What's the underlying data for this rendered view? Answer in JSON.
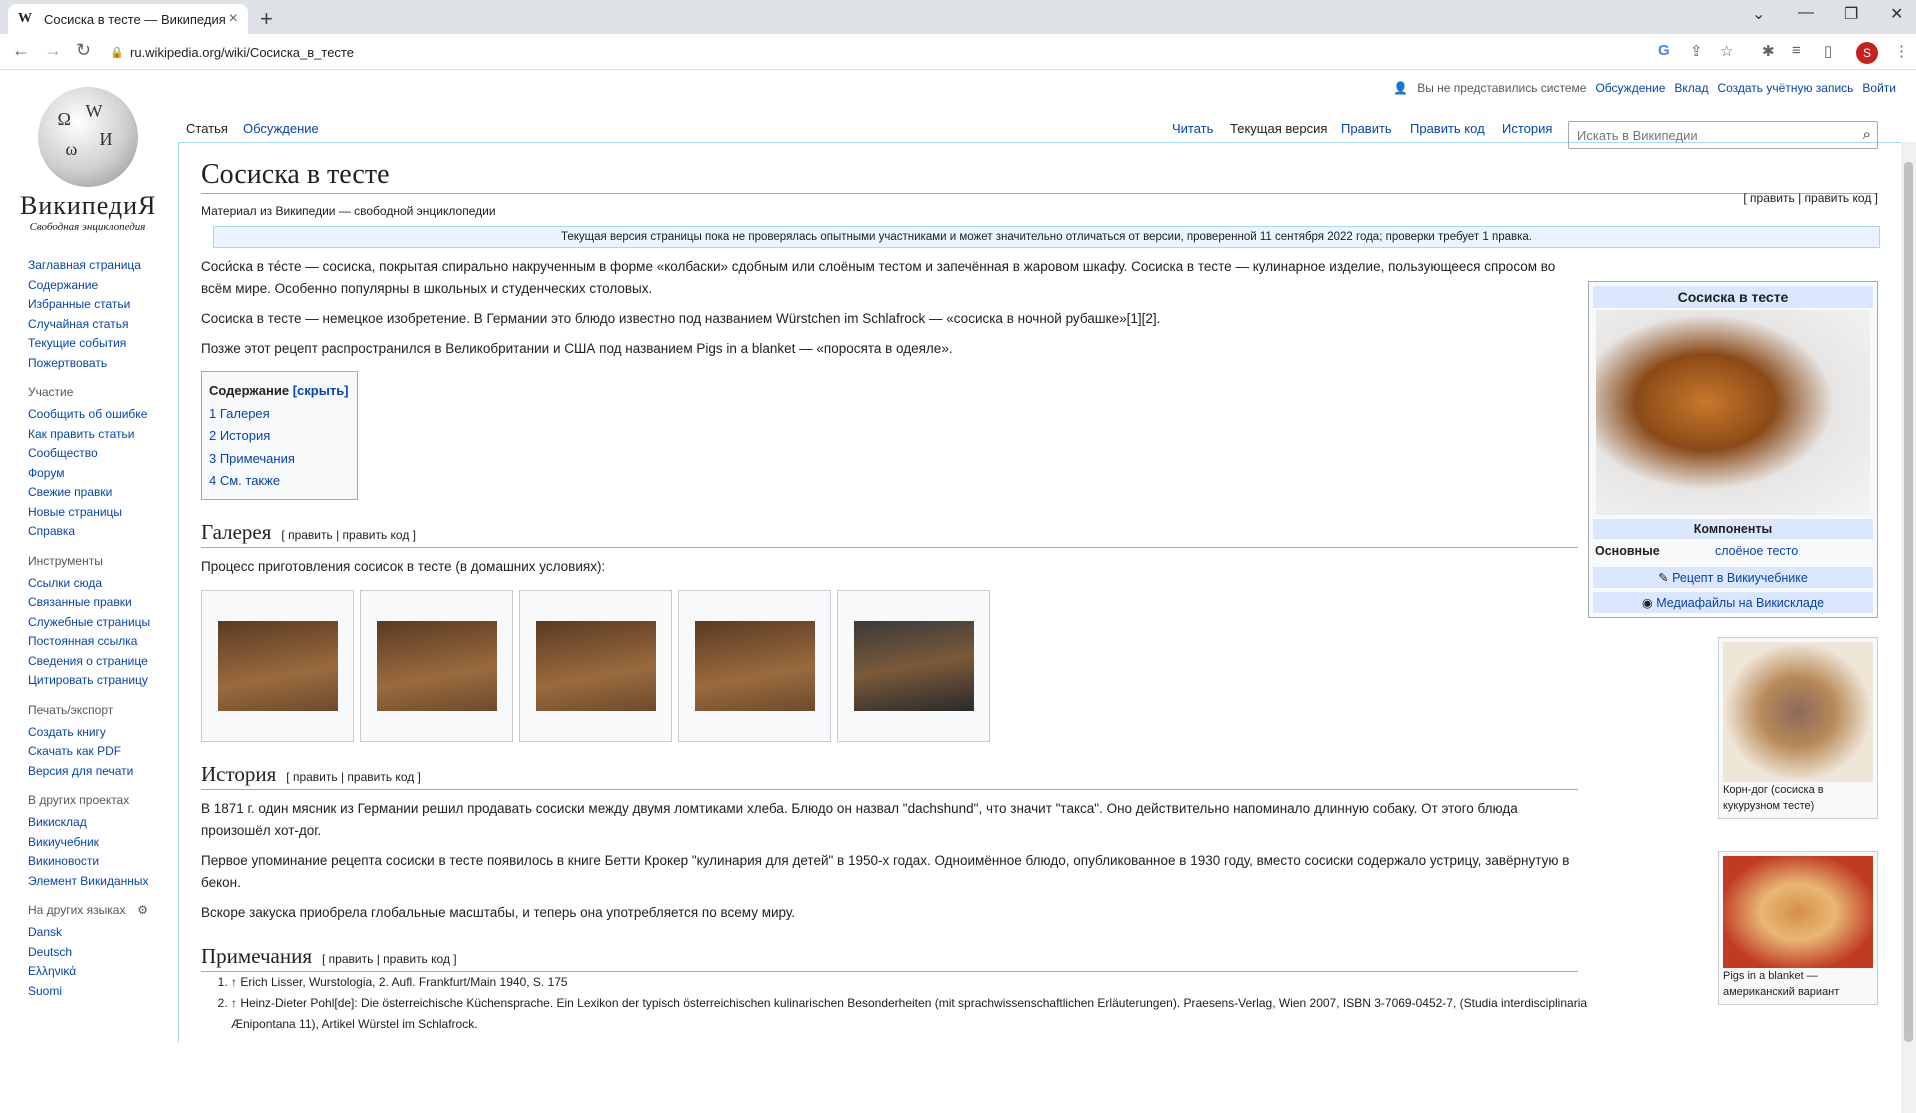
{
  "browser": {
    "tab_title": "Сосиска в тесте — Википедия",
    "url": "ru.wikipedia.org/wiki/Сосиска_в_тесте",
    "profile_letter": "S"
  },
  "logo": {
    "wordmark": "ВикипедиЯ",
    "tagline": "Свободная энциклопедия"
  },
  "personal": {
    "not_logged": "Вы не представились системе",
    "talk": "Обсуждение",
    "contrib": "Вклад",
    "create": "Создать учётную запись",
    "login": "Войти"
  },
  "tabs": {
    "article": "Статья",
    "talk": "Обсуждение",
    "read": "Читать",
    "current": "Текущая версия",
    "edit": "Править",
    "editcode": "Править код",
    "history": "История"
  },
  "search": {
    "placeholder": "Искать в Википедии"
  },
  "sidebar": {
    "main": [
      "Заглавная страница",
      "Содержание",
      "Избранные статьи",
      "Случайная статья",
      "Текущие события",
      "Пожертвовать"
    ],
    "participation": {
      "title": "Участие",
      "items": [
        "Сообщить об ошибке",
        "Как править статьи",
        "Сообщество",
        "Форум",
        "Свежие правки",
        "Новые страницы",
        "Справка"
      ]
    },
    "tools": {
      "title": "Инструменты",
      "items": [
        "Ссылки сюда",
        "Связанные правки",
        "Служебные страницы",
        "Постоянная ссылка",
        "Сведения о странице",
        "Цитировать страницу"
      ]
    },
    "print": {
      "title": "Печать/экспорт",
      "items": [
        "Создать книгу",
        "Скачать как PDF",
        "Версия для печати"
      ]
    },
    "projects": {
      "title": "В других проектах",
      "items": [
        "Викисклад",
        "Викиучебник",
        "Викиновости",
        "Элемент Викиданных"
      ]
    },
    "langs": {
      "title": "На других языках",
      "items": [
        "Dansk",
        "Deutsch",
        "Ελληνικά",
        "Suomi"
      ]
    }
  },
  "article": {
    "title": "Сосиска в тесте",
    "sitesub": "Материал из Википедии — свободной энциклопедии",
    "editlinks": "[ править | править код ]",
    "flag": "Текущая версия страницы пока не проверялась опытными участниками и может значительно отличаться от версии, проверенной 11 сентября 2022 года; проверки требует 1 правка.",
    "p1": "Соси́ска в те́сте — сосиска, покрытая спирально накрученным в форме «колбаски» сдобным или слоёным тестом и запечённая в жаровом шкафу. Сосиска в тесте — кулинарное изделие, пользующееся спросом во всём мире. Особенно популярны в школьных и студенческих столовых.",
    "p2": "Сосиска в тесте — немецкое изобретение. В Германии это блюдо известно под названием Würstchen im Schlafrock — «сосиска в ночной рубашке»[1][2].",
    "p3": "Позже этот рецепт распространился в Великобритании и США под названием Pigs in a blanket — «поросята в одеяле».",
    "toc": {
      "title": "Содержание",
      "hide": "[скрыть]",
      "items": [
        "1 Галерея",
        "2 История",
        "3 Примечания",
        "4 См. также"
      ]
    },
    "gallery": {
      "heading": "Галерея",
      "caption": "Процесс приготовления сосисок в тесте (в домашних условиях):"
    },
    "history": {
      "heading": "История",
      "p1": "В 1871 г. один мясник из Германии решил продавать сосиски между двумя ломтиками хлеба. Блюдо он назвал \"dachshund\", что значит \"такса\". Оно действительно напоминало длинную собаку. От этого блюда произошёл хот-дог.",
      "p2": "Первое упоминание рецепта сосиски в тесте появилось в книге Бетти Крокер \"кулинария для детей\" в 1950-х годах. Одноимённое блюдо, опубликованное в 1930 году, вместо сосиски содержало устрицу, завёрнутую в бекон.",
      "p3": "Вскоре закуска приобрела глобальные масштабы, и теперь она употребляется по всему миру."
    },
    "notes": {
      "heading": "Примечания",
      "items": [
        "↑ Erich Lisser, Wurstologia, 2. Aufl. Frankfurt/Main 1940, S. 175",
        "↑ Heinz-Dieter Pohl[de]: Die österreichische Küchensprache. Ein Lexikon der typisch österreichischen kulinarischen Besonderheiten (mit sprachwissenschaftlichen Erläuterungen). Praesens-Verlag, Wien 2007, ISBN 3-7069-0452-7, (Studia interdisciplinaria Ænipontana 11), Artikel Würstel im Schlafrock."
      ]
    },
    "section_edit": "[ править | править код ]"
  },
  "infobox": {
    "title": "Сосиска в тесте",
    "components": "Компоненты",
    "main_label": "Основные",
    "main_value": "слоёное тесто",
    "recipe": "Рецепт в Викиучебнике",
    "media": "Медиафайлы на Викискладе"
  },
  "thumbs": [
    {
      "caption": "Корн-дог (сосиска в кукурузном тесте)"
    },
    {
      "caption": "Pigs in a blanket — американский вариант"
    }
  ]
}
